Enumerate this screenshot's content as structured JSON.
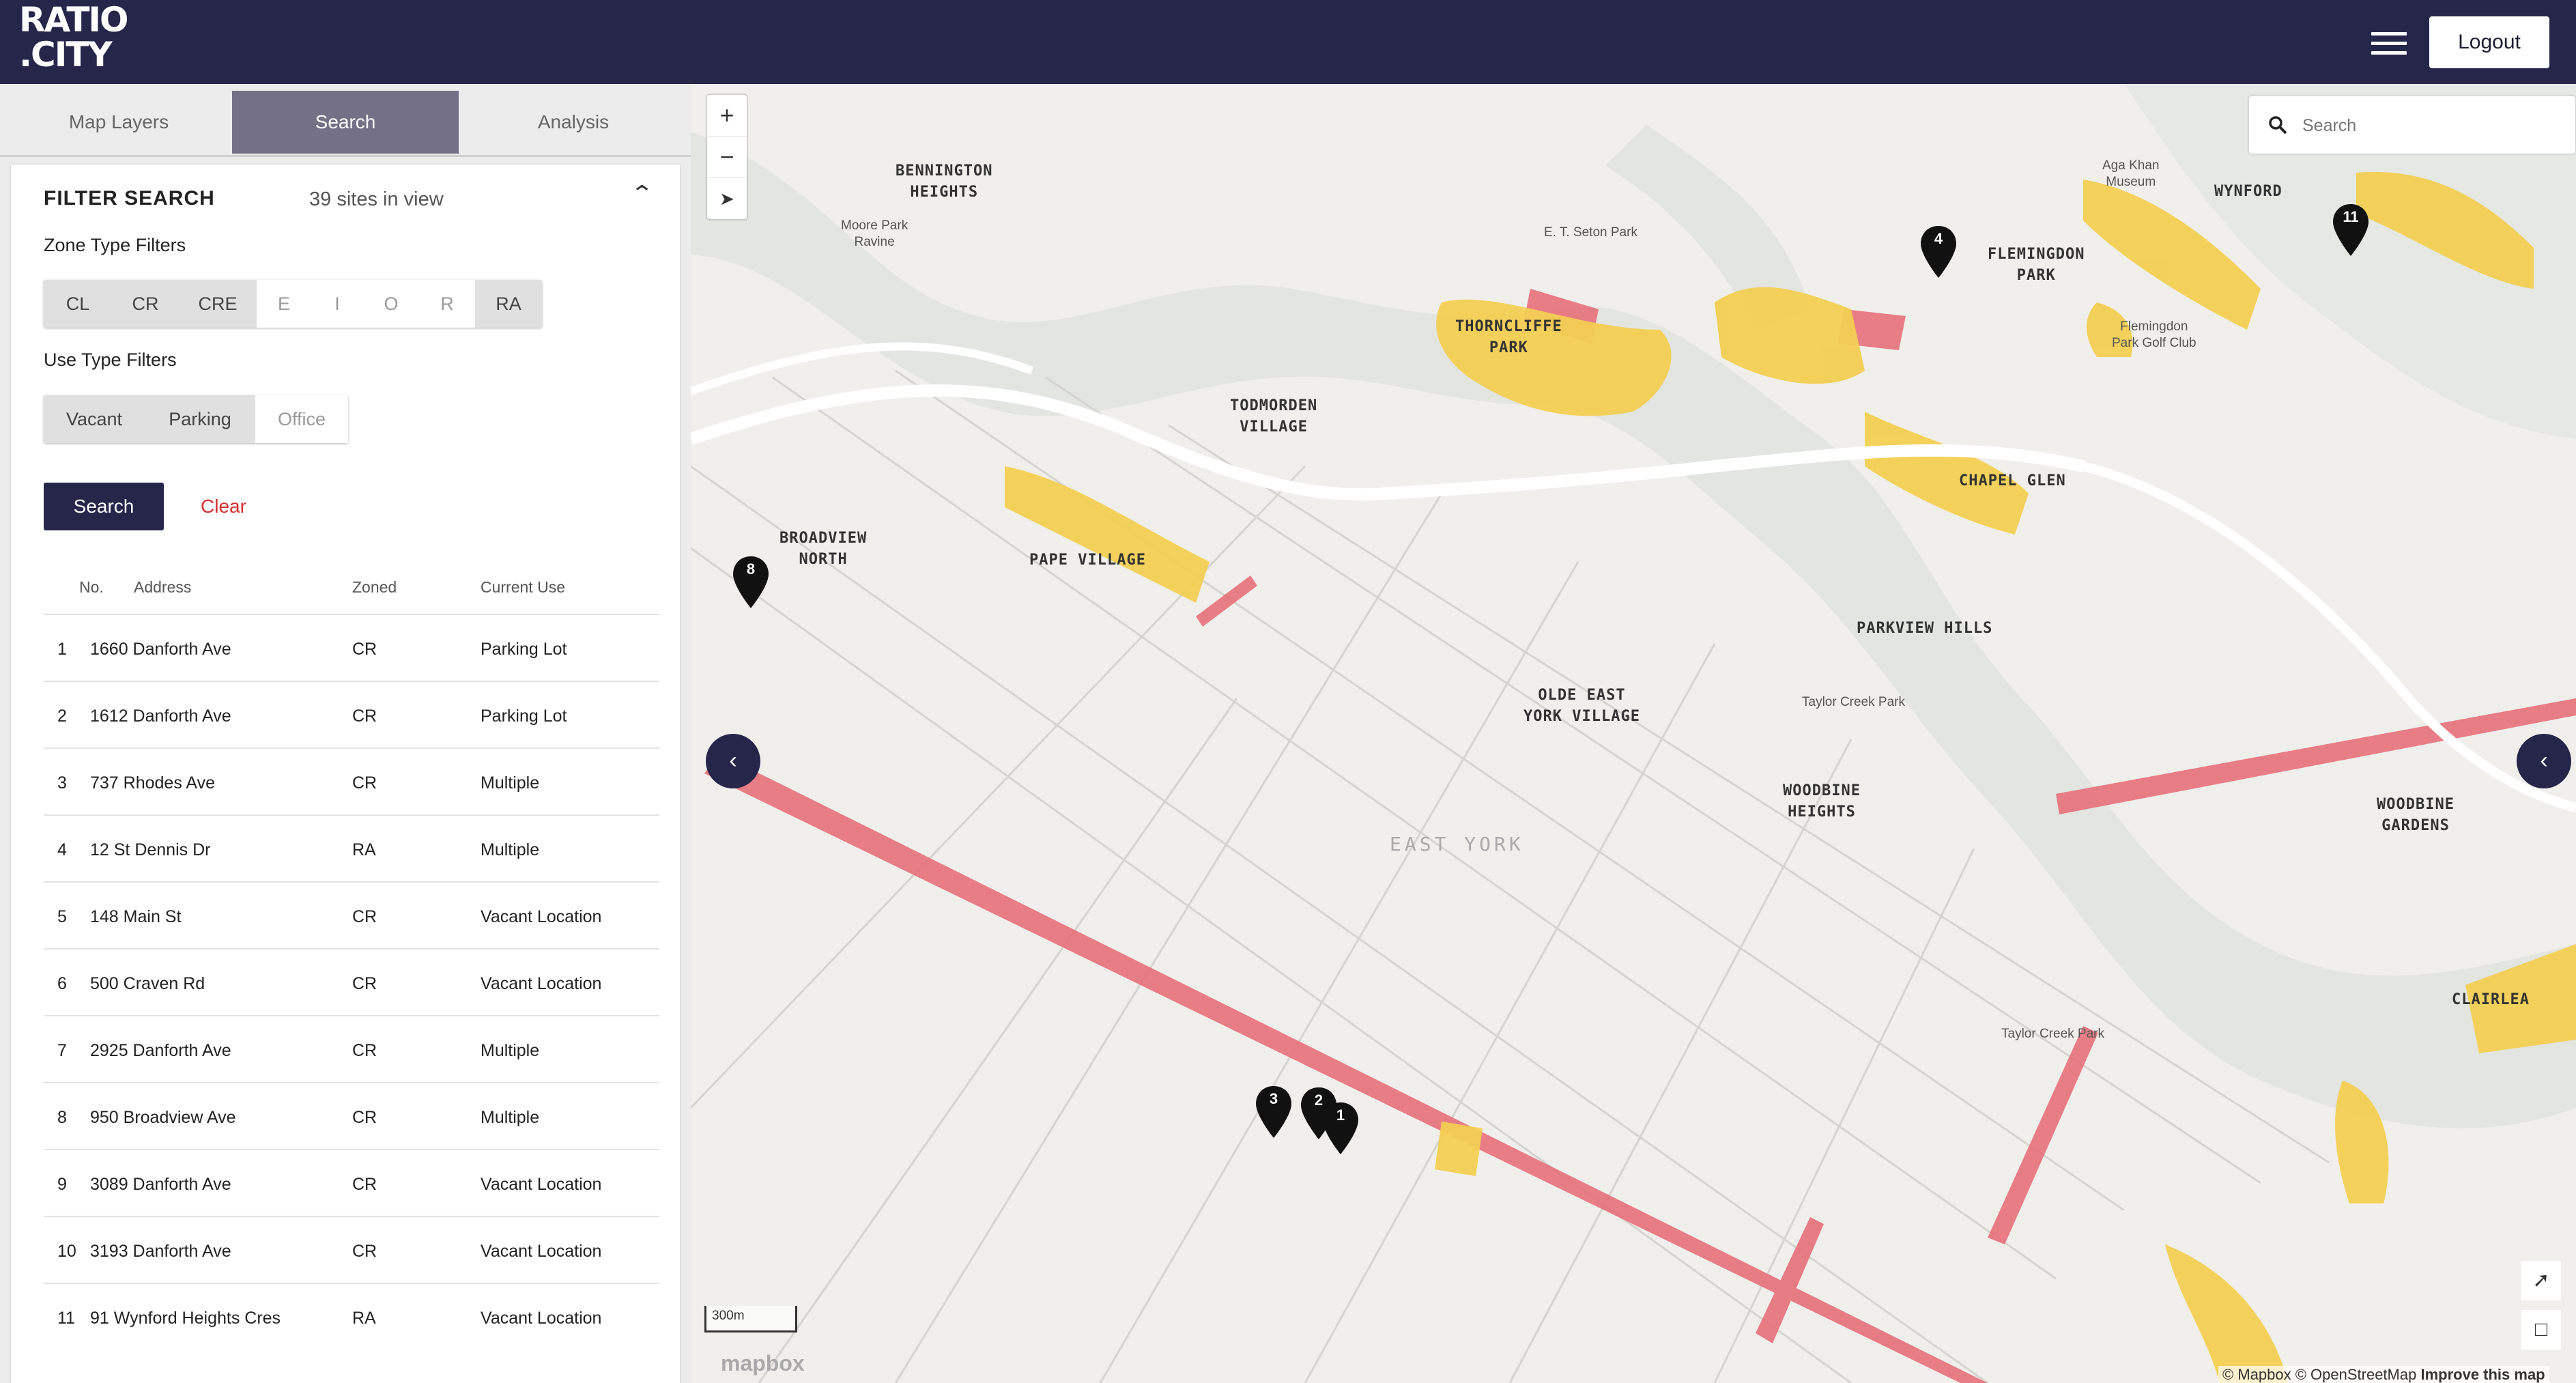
{
  "header": {
    "logo_line1": "RATIO",
    "logo_line2": ".CITY",
    "logout_label": "Logout",
    "menu_icon": "hamburger-icon"
  },
  "tabs": [
    {
      "label": "Map Layers",
      "active": false
    },
    {
      "label": "Search",
      "active": true
    },
    {
      "label": "Analysis",
      "active": false
    }
  ],
  "filter": {
    "title": "FILTER SEARCH",
    "sites_in_view": "39 sites in view",
    "zone_label": "Zone Type Filters",
    "zone_options": [
      {
        "label": "CL",
        "selected": true
      },
      {
        "label": "CR",
        "selected": true
      },
      {
        "label": "CRE",
        "selected": true
      },
      {
        "label": "E",
        "selected": false
      },
      {
        "label": "I",
        "selected": false
      },
      {
        "label": "O",
        "selected": false
      },
      {
        "label": "R",
        "selected": false
      },
      {
        "label": "RA",
        "selected": true
      }
    ],
    "use_label": "Use Type Filters",
    "use_options": [
      {
        "label": "Vacant",
        "selected": true
      },
      {
        "label": "Parking",
        "selected": true
      },
      {
        "label": "Office",
        "selected": false
      }
    ],
    "search_label": "Search",
    "clear_label": "Clear"
  },
  "results": {
    "headers": [
      "No.",
      "Address",
      "Zoned",
      "Current Use"
    ],
    "rows": [
      {
        "no": "1",
        "address": "1660 Danforth Ave",
        "zoned": "CR",
        "use": "Parking Lot"
      },
      {
        "no": "2",
        "address": "1612 Danforth Ave",
        "zoned": "CR",
        "use": "Parking Lot"
      },
      {
        "no": "3",
        "address": "737 Rhodes Ave",
        "zoned": "CR",
        "use": "Multiple"
      },
      {
        "no": "4",
        "address": "12 St Dennis Dr",
        "zoned": "RA",
        "use": "Multiple"
      },
      {
        "no": "5",
        "address": "148 Main St",
        "zoned": "CR",
        "use": "Vacant Location"
      },
      {
        "no": "6",
        "address": "500 Craven Rd",
        "zoned": "CR",
        "use": "Vacant Location"
      },
      {
        "no": "7",
        "address": "2925 Danforth Ave",
        "zoned": "CR",
        "use": "Multiple"
      },
      {
        "no": "8",
        "address": "950 Broadview Ave",
        "zoned": "CR",
        "use": "Multiple"
      },
      {
        "no": "9",
        "address": "3089 Danforth Ave",
        "zoned": "CR",
        "use": "Vacant Location"
      },
      {
        "no": "10",
        "address": "3193 Danforth Ave",
        "zoned": "CR",
        "use": "Vacant Location"
      },
      {
        "no": "11",
        "address": "91 Wynford Heights Cres",
        "zoned": "RA",
        "use": "Vacant Location"
      }
    ]
  },
  "map": {
    "search_placeholder": "Search",
    "zoom_in": "+",
    "zoom_out": "−",
    "scale_label": "300m",
    "attribution": "© Mapbox © OpenStreetMap",
    "improve_link": "Improve this map",
    "mapbox_logo": "mapbox",
    "markers": [
      "1",
      "2",
      "3",
      "4",
      "8",
      "11"
    ],
    "places": {
      "bennington": [
        "BENNINGTON",
        "HEIGHTS"
      ],
      "moore_park": [
        "Moore Park",
        "Ravine"
      ],
      "todmorden": [
        "TODMORDEN",
        "VILLAGE"
      ],
      "thorncliffe": [
        "THORNCLIFFE",
        "PARK"
      ],
      "seton": "E. T. Seton Park",
      "flemingdon": [
        "FLEMINGDON",
        "PARK"
      ],
      "aga_khan": [
        "Aga Khan",
        "Museum"
      ],
      "wynford": "WYNFORD",
      "flemingdon_golf": [
        "Flemingdon",
        "Park Golf Club"
      ],
      "broadview": [
        "BROADVIEW",
        "NORTH"
      ],
      "pape": "PAPE VILLAGE",
      "chapel_glen": "CHAPEL GLEN",
      "parkview": "PARKVIEW HILLS",
      "taylor_creek_1": "Taylor Creek Park",
      "olde_east": [
        "OLDE EAST",
        "YORK VILLAGE"
      ],
      "east_york": "EAST YORK",
      "woodbine_heights": [
        "WOODBINE",
        "HEIGHTS"
      ],
      "woodbine_gardens": [
        "WOODBINE",
        "GARDENS"
      ],
      "clairlea": "CLAIRLEA",
      "taylor_creek_2": "Taylor Creek Park"
    }
  },
  "colors": {
    "header": "#25264a",
    "active_tab": "#747085",
    "clear": "#d32f2f",
    "zone_red": "#e8707a",
    "zone_yellow": "#f3cf52"
  }
}
